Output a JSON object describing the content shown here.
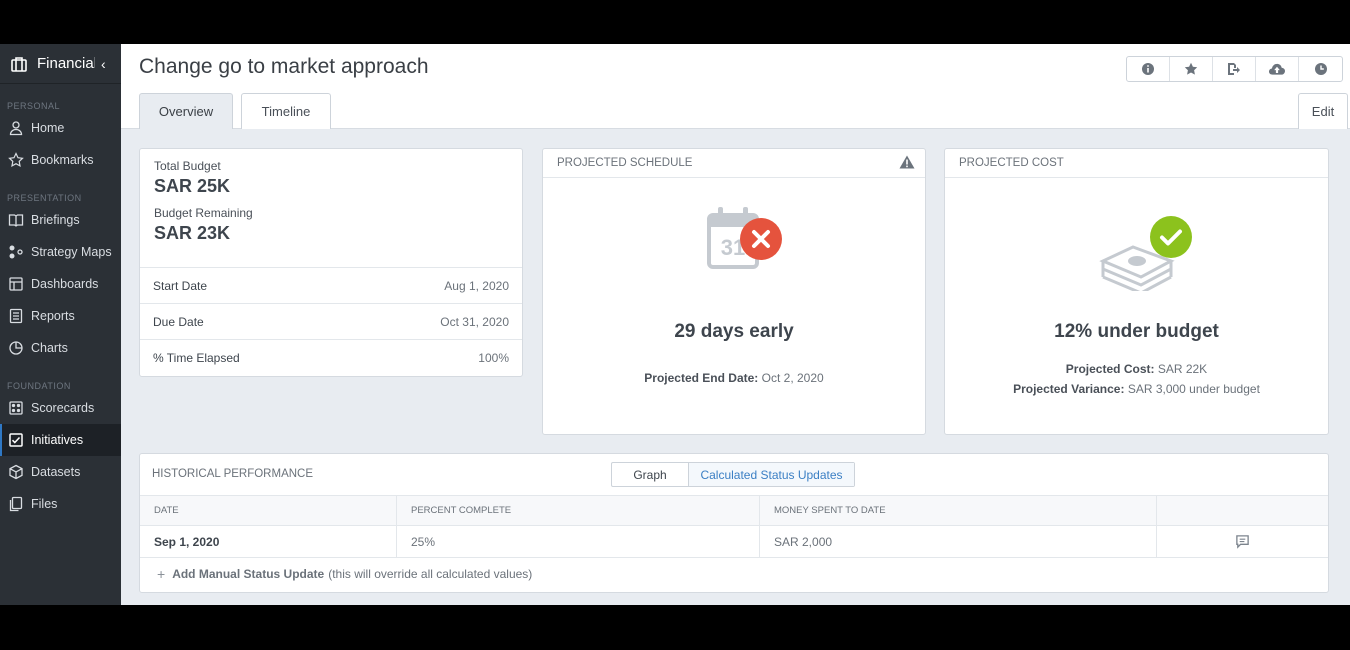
{
  "sidebar": {
    "app_title": "Financial",
    "collapse_glyph": "‹",
    "sections": {
      "personal": "PERSONAL",
      "presentation": "PRESENTATION",
      "foundation": "FOUNDATION"
    },
    "items": [
      {
        "label": "Home",
        "icon": "user-icon"
      },
      {
        "label": "Bookmarks",
        "icon": "star-icon"
      },
      {
        "label": "Briefings",
        "icon": "book-icon"
      },
      {
        "label": "Strategy Maps",
        "icon": "strategy-map-icon"
      },
      {
        "label": "Dashboards",
        "icon": "dashboard-icon"
      },
      {
        "label": "Reports",
        "icon": "report-icon"
      },
      {
        "label": "Charts",
        "icon": "pie-chart-icon"
      },
      {
        "label": "Scorecards",
        "icon": "scorecard-icon"
      },
      {
        "label": "Initiatives",
        "icon": "checkbox-icon",
        "active": true
      },
      {
        "label": "Datasets",
        "icon": "cube-icon"
      },
      {
        "label": "Files",
        "icon": "files-icon"
      }
    ]
  },
  "header": {
    "title": "Change go to market approach",
    "tabs": [
      "Overview",
      "Timeline"
    ],
    "active_tab": "Overview",
    "edit_label": "Edit",
    "toolbar_icons": [
      "info-icon",
      "star-icon",
      "export-icon",
      "cloud-upload-icon",
      "clock-icon"
    ]
  },
  "budget": {
    "total_label": "Total Budget",
    "total_value": "SAR 25K",
    "remaining_label": "Budget Remaining",
    "remaining_value": "SAR 23K",
    "rows": [
      {
        "label": "Start Date",
        "value": "Aug 1, 2020"
      },
      {
        "label": "Due Date",
        "value": "Oct 31, 2020"
      },
      {
        "label": "% Time Elapsed",
        "value": "100%"
      }
    ]
  },
  "schedule": {
    "title": "PROJECTED SCHEDULE",
    "calendar_day": "31",
    "headline": "29 days early",
    "end_date_label": "Projected End Date:",
    "end_date_value": "Oct 2, 2020",
    "status_color": "#e5533d"
  },
  "cost": {
    "title": "PROJECTED COST",
    "headline": "12% under budget",
    "cost_label": "Projected Cost:",
    "cost_value": "SAR 22K",
    "variance_label": "Projected Variance:",
    "variance_value": "SAR 3,000 under budget",
    "status_color": "#8cc21d"
  },
  "history": {
    "title": "HISTORICAL PERFORMANCE",
    "toggle_graph": "Graph",
    "toggle_calc": "Calculated Status Updates",
    "columns": [
      "DATE",
      "PERCENT COMPLETE",
      "MONEY SPENT TO DATE",
      ""
    ],
    "rows": [
      {
        "date": "Sep 1, 2020",
        "percent": "25%",
        "money": "SAR 2,000"
      }
    ],
    "add_label": "Add Manual Status Update",
    "add_note": "(this will override all calculated values)"
  }
}
